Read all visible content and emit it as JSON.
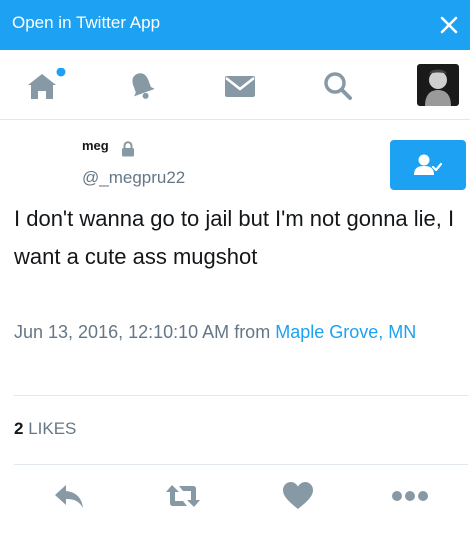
{
  "banner": {
    "open_app_label": "Open in Twitter App"
  },
  "nav": {
    "items": [
      {
        "icon": "home-icon",
        "has_notification_dot": true
      },
      {
        "icon": "bell-icon"
      },
      {
        "icon": "envelope-icon"
      },
      {
        "icon": "search-icon"
      },
      {
        "icon": "avatar"
      }
    ]
  },
  "tweet": {
    "display_name": "meg",
    "handle": "@_megpru22",
    "protected": true,
    "text": "I don't wanna go to jail but I'm not gonna lie, I want a cute ass mugshot",
    "timestamp": "Jun 13, 2016, 12:10:10 AM",
    "from_label": "from",
    "location": "Maple Grove, MN",
    "likes_count": "2",
    "likes_label": "LIKES"
  },
  "colors": {
    "accent": "#1da1f2",
    "muted_text": "#657786",
    "icon_gray": "#8899a6",
    "divider": "#e1e8ed"
  }
}
